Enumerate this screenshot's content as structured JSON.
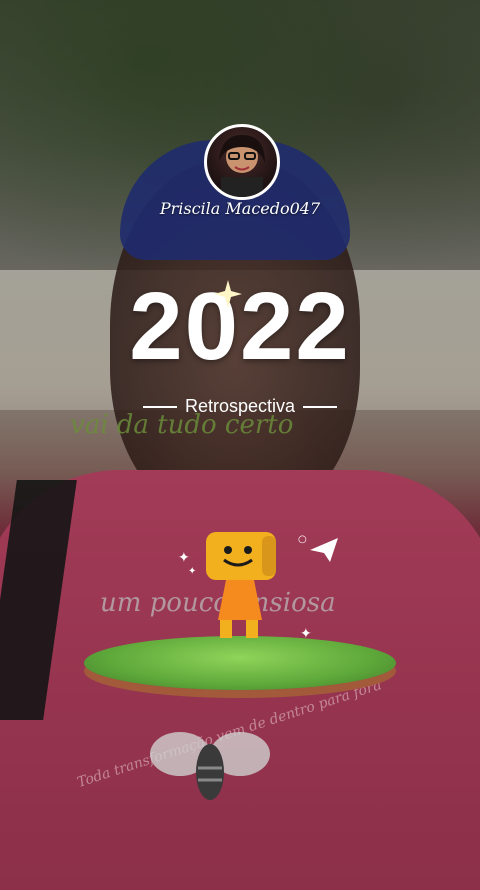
{
  "header": {
    "username": "Priscila Macedo047"
  },
  "hero": {
    "year": "2022",
    "subtitle": "Retrospectiva"
  },
  "background_text": {
    "line1": "vai da tudo certo",
    "line2": "um pouco ansiosa",
    "line3": "Toda transformação vem de dentro para fora"
  },
  "icons": {
    "sparkle": "sparkle-icon",
    "plane": "paper-plane-icon",
    "mascot": "smiley-mascot-icon",
    "bee": "bee-icon"
  },
  "colors": {
    "shirt": "#a23b57",
    "island_grass": "#5ea83a",
    "mascot_yellow": "#f2b01e",
    "text": "#ffffff"
  }
}
